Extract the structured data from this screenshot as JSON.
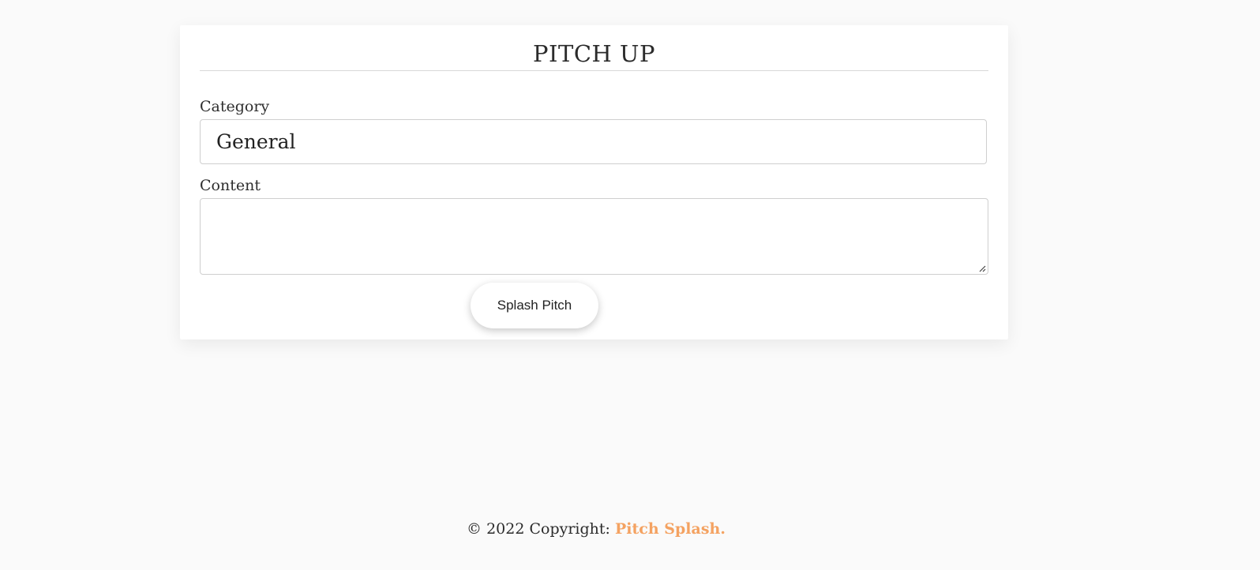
{
  "form": {
    "title": "PITCH UP",
    "category_label": "Category",
    "category_value": "General",
    "content_label": "Content",
    "content_value": "",
    "submit_label": "Splash Pitch"
  },
  "footer": {
    "copyright_text": "© 2022 Copyright: ",
    "brand_link": "Pitch Splash."
  },
  "colors": {
    "background": "#fafafa",
    "card": "#ffffff",
    "brand_accent": "#f4a261"
  }
}
